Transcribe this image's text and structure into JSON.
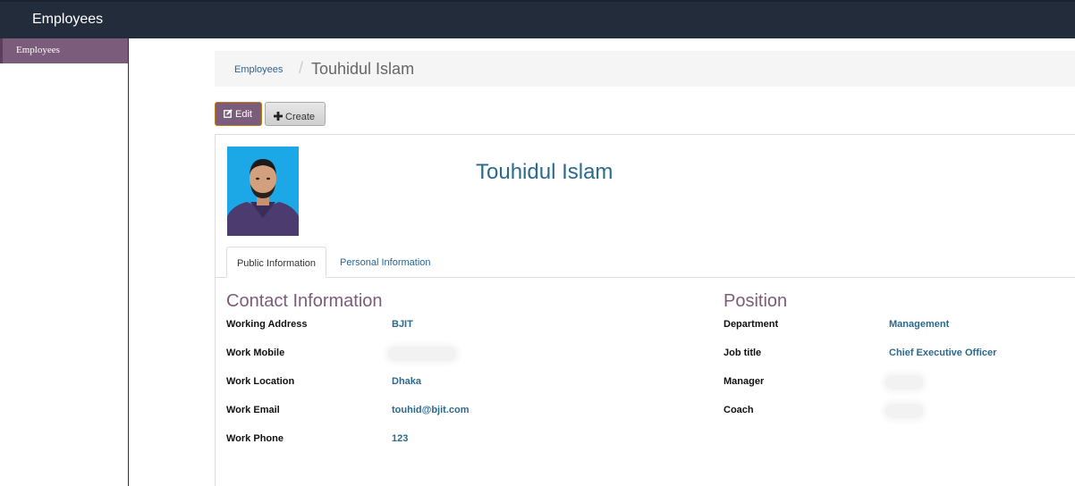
{
  "header": {
    "app_title": "Employees"
  },
  "sidebar": {
    "items": [
      {
        "label": "Employees"
      }
    ]
  },
  "breadcrumb": {
    "parent": "Employees",
    "separator": "/",
    "current": "Touhidul Islam"
  },
  "toolbar": {
    "edit_label": "Edit",
    "create_label": "Create",
    "edit_icon": "edit-icon",
    "create_icon": "plus-icon"
  },
  "employee": {
    "name": "Touhidul Islam",
    "photo": "employee-photo"
  },
  "tabs": [
    {
      "label": "Public Information",
      "active": true
    },
    {
      "label": "Personal Information",
      "active": false
    }
  ],
  "contact": {
    "title": "Contact Information",
    "fields": [
      {
        "label": "Working Address",
        "value": "BJIT"
      },
      {
        "label": "Work Mobile",
        "value": ""
      },
      {
        "label": "Work Location",
        "value": "Dhaka"
      },
      {
        "label": "Work Email",
        "value": "touhid@bjit.com"
      },
      {
        "label": "Work Phone",
        "value": "123"
      }
    ]
  },
  "position": {
    "title": "Position",
    "fields": [
      {
        "label": "Department",
        "value": "Management"
      },
      {
        "label": "Job title",
        "value": "Chief Executive Officer"
      },
      {
        "label": "Manager",
        "value": ""
      },
      {
        "label": "Coach",
        "value": ""
      }
    ]
  },
  "colors": {
    "topbar": "#232c3b",
    "accent": "#7c5c7b",
    "link": "#2a6496",
    "value": "#2a6a8e"
  }
}
